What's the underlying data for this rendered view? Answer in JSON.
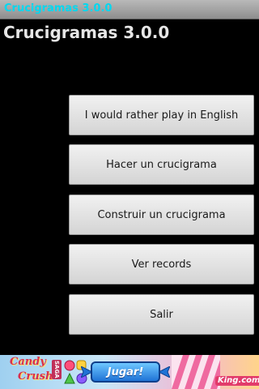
{
  "window": {
    "title": "Crucigramas 3.0.0",
    "title_color": "#00d8f0"
  },
  "heading": "Crucigramas 3.0.0",
  "menu": {
    "buttons": [
      {
        "label": "I would rather play in English"
      },
      {
        "label": "Hacer un crucigrama"
      },
      {
        "label": "Construir un crucigrama"
      },
      {
        "label": "Ver records"
      },
      {
        "label": "Salir"
      }
    ]
  },
  "ad": {
    "brand_line1": "Candy",
    "brand_line2": "Crush",
    "brand_tag": "SAGA",
    "cta_label": "Jugar!",
    "advertiser": "King.com"
  }
}
